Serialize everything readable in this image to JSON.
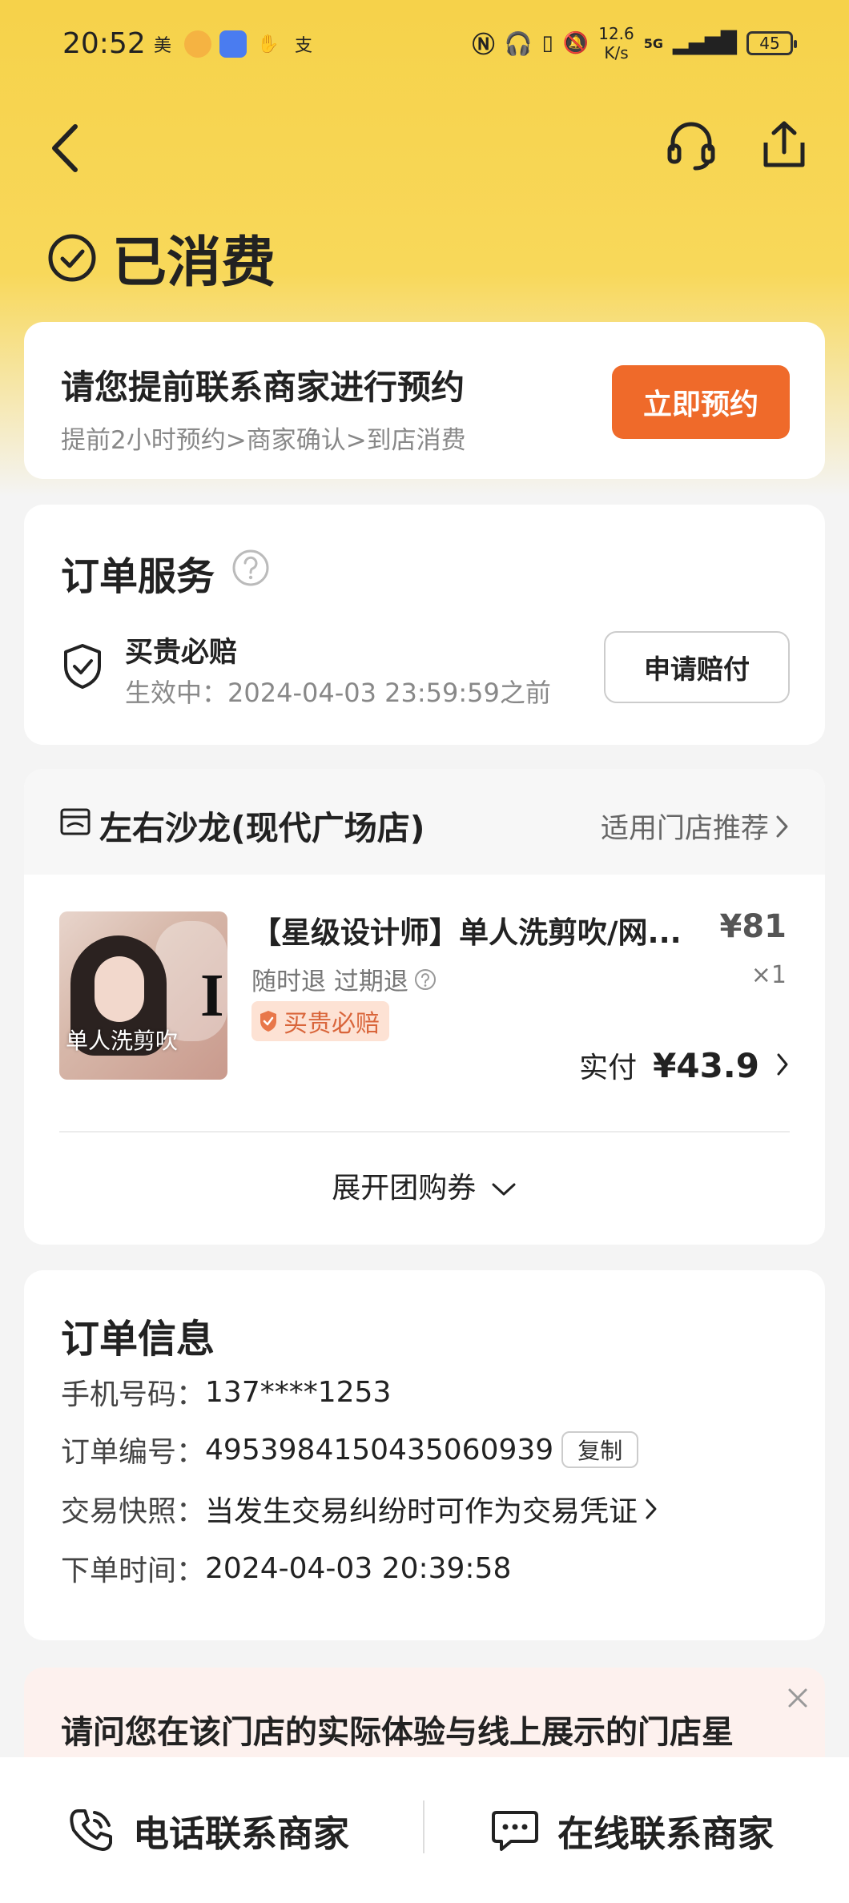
{
  "status_bar": {
    "time": "20:52",
    "left_icons": [
      "美",
      "支"
    ],
    "net_speed_value": "12.6",
    "net_speed_unit": "K/s",
    "network": "5G",
    "battery": "45"
  },
  "header": {
    "status_title": "已消费"
  },
  "booking": {
    "title": "请您提前联系商家进行预约",
    "subtitle": "提前2小时预约>商家确认>到店消费",
    "button": "立即预约"
  },
  "service": {
    "title": "订单服务",
    "guarantee_name": "买贵必赔",
    "guarantee_time": "生效中：2024-04-03 23:59:59之前",
    "claim_button": "申请赔付"
  },
  "store": {
    "name": "左右沙龙(现代广场店)",
    "recommend_link": "适用门店推荐",
    "product": {
      "name": "【星级设计师】单人洗剪吹/网...",
      "price": "¥81",
      "tags": "随时退 过期退",
      "quantity": "×1",
      "badge": "买贵必赔",
      "image_caption": "单人洗剪吹",
      "image_letter": "I",
      "paid_label": "实付",
      "paid_value": "¥43.9"
    },
    "expand_label": "展开团购券"
  },
  "order_info": {
    "title": "订单信息",
    "rows": [
      {
        "label": "手机号码：",
        "value": "137****1253"
      },
      {
        "label": "订单编号：",
        "value": "4953984150435060939"
      },
      {
        "label": "交易快照：",
        "value": "当发生交易纠纷时可作为交易凭证"
      },
      {
        "label": "下单时间：",
        "value": "2024-04-03 20:39:58"
      }
    ],
    "copy_button": "复制"
  },
  "survey": {
    "text": "请问您在该门店的实际体验与线上展示的门店星"
  },
  "bottom_bar": {
    "call_label": "电话联系商家",
    "chat_label": "在线联系商家"
  },
  "colors": {
    "header_yellow": "#f6d24a",
    "accent_orange": "#ef6a2a",
    "badge_bg": "#fde2d4",
    "badge_text": "#d9653a"
  },
  "icons": [
    "back-icon",
    "customer-service-icon",
    "share-icon",
    "check-circle-icon",
    "help-icon",
    "shield-check-icon",
    "store-icon",
    "chevron-right-icon",
    "chevron-down-icon",
    "close-icon",
    "phone-icon",
    "chat-icon"
  ]
}
